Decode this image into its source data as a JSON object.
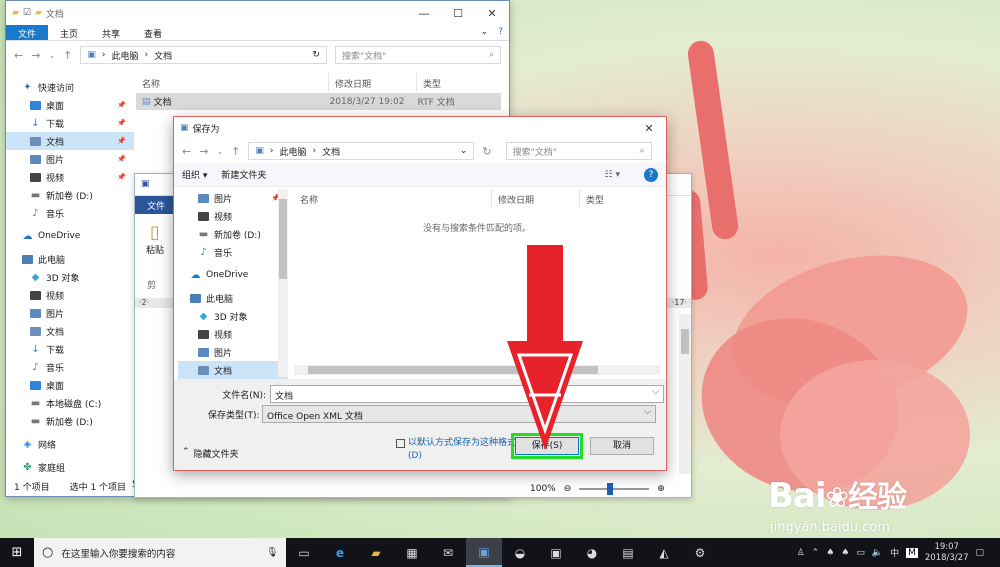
{
  "explorer": {
    "title": "文档",
    "ribbon_tabs": [
      "文件",
      "主页",
      "共享",
      "查看"
    ],
    "breadcrumb": [
      "此电脑",
      "文档"
    ],
    "search_placeholder": "搜索\"文档\"",
    "sidebar": [
      {
        "label": "快速访问",
        "icon": "star-icon",
        "top": true
      },
      {
        "label": "桌面",
        "icon": "desktop-icon",
        "pinned": true
      },
      {
        "label": "下载",
        "icon": "download-icon",
        "pinned": true
      },
      {
        "label": "文档",
        "icon": "document-icon",
        "pinned": true,
        "selected": true
      },
      {
        "label": "图片",
        "icon": "picture-icon",
        "pinned": true
      },
      {
        "label": "视频",
        "icon": "video-icon",
        "pinned": true
      },
      {
        "label": "新加卷 (D:)",
        "icon": "drive-icon"
      },
      {
        "label": "音乐",
        "icon": "music-icon"
      },
      {
        "label": "OneDrive",
        "icon": "cloud-icon",
        "top": true
      },
      {
        "label": "此电脑",
        "icon": "computer-icon",
        "top": true
      },
      {
        "label": "3D 对象",
        "icon": "cube-icon"
      },
      {
        "label": "视频",
        "icon": "video-icon"
      },
      {
        "label": "图片",
        "icon": "picture-icon"
      },
      {
        "label": "文档",
        "icon": "document-icon"
      },
      {
        "label": "下载",
        "icon": "download-icon"
      },
      {
        "label": "音乐",
        "icon": "music-icon"
      },
      {
        "label": "桌面",
        "icon": "desktop-icon"
      },
      {
        "label": "本地磁盘 (C:)",
        "icon": "drive-icon"
      },
      {
        "label": "新加卷 (D:)",
        "icon": "drive-icon"
      },
      {
        "label": "网络",
        "icon": "network-icon",
        "top": true
      },
      {
        "label": "家庭组",
        "icon": "homegroup-icon",
        "top": true
      }
    ],
    "columns": [
      "名称",
      "修改日期",
      "类型"
    ],
    "file": {
      "name": "文档",
      "date": "2018/3/27 19:02",
      "type": "RTF 文档"
    },
    "status": {
      "count": "1 个项目",
      "selected": "选中 1 个项目",
      "extra": "5"
    }
  },
  "word": {
    "file_tab": "文件",
    "paste_label": "粘贴",
    "clip_label": "剪",
    "ruler_left": "·2·",
    "ruler_right": "·17·",
    "zoom": "100%",
    "minus": "⊖",
    "plus": "⊕"
  },
  "dialog": {
    "title": "保存为",
    "breadcrumb": [
      "此电脑",
      "文档"
    ],
    "search_placeholder": "搜索\"文档\"",
    "organize": "组织 ▾",
    "new_folder": "新建文件夹",
    "help": "?",
    "sidebar": [
      {
        "label": "图片",
        "icon": "picture-icon",
        "pinned": true
      },
      {
        "label": "视频",
        "icon": "video-icon"
      },
      {
        "label": "新加卷 (D:)",
        "icon": "drive-icon"
      },
      {
        "label": "音乐",
        "icon": "music-icon"
      },
      {
        "label": "OneDrive",
        "icon": "cloud-icon",
        "top": true
      },
      {
        "label": "此电脑",
        "icon": "computer-icon",
        "top": true
      },
      {
        "label": "3D 对象",
        "icon": "cube-icon"
      },
      {
        "label": "视频",
        "icon": "video-icon"
      },
      {
        "label": "图片",
        "icon": "picture-icon"
      },
      {
        "label": "文档",
        "icon": "document-icon",
        "selected": true
      }
    ],
    "columns": [
      "名称",
      "修改日期",
      "类型"
    ],
    "empty_text": "没有与搜索条件匹配的项。",
    "filename_label": "文件名(N):",
    "filename_value": "文档",
    "filetype_label": "保存类型(T):",
    "filetype_value": "Office Open XML 文档",
    "default_format": "以默认方式保存为这种格式(D)",
    "save": "保存(S)",
    "cancel": "取消",
    "hide_folders": "隐藏文件夹"
  },
  "taskbar": {
    "search_placeholder": "在这里输入你要搜索的内容",
    "ime": "中",
    "ime_mode": "M",
    "time": "19:07",
    "date": "2018/3/27"
  },
  "watermark": {
    "brand": "Bai",
    "brand2": "经验",
    "url": "jingyan.baidu.com"
  },
  "colors": {
    "accent": "#1979ca",
    "highlight": "#22dd22",
    "arrow": "#e8222b"
  }
}
